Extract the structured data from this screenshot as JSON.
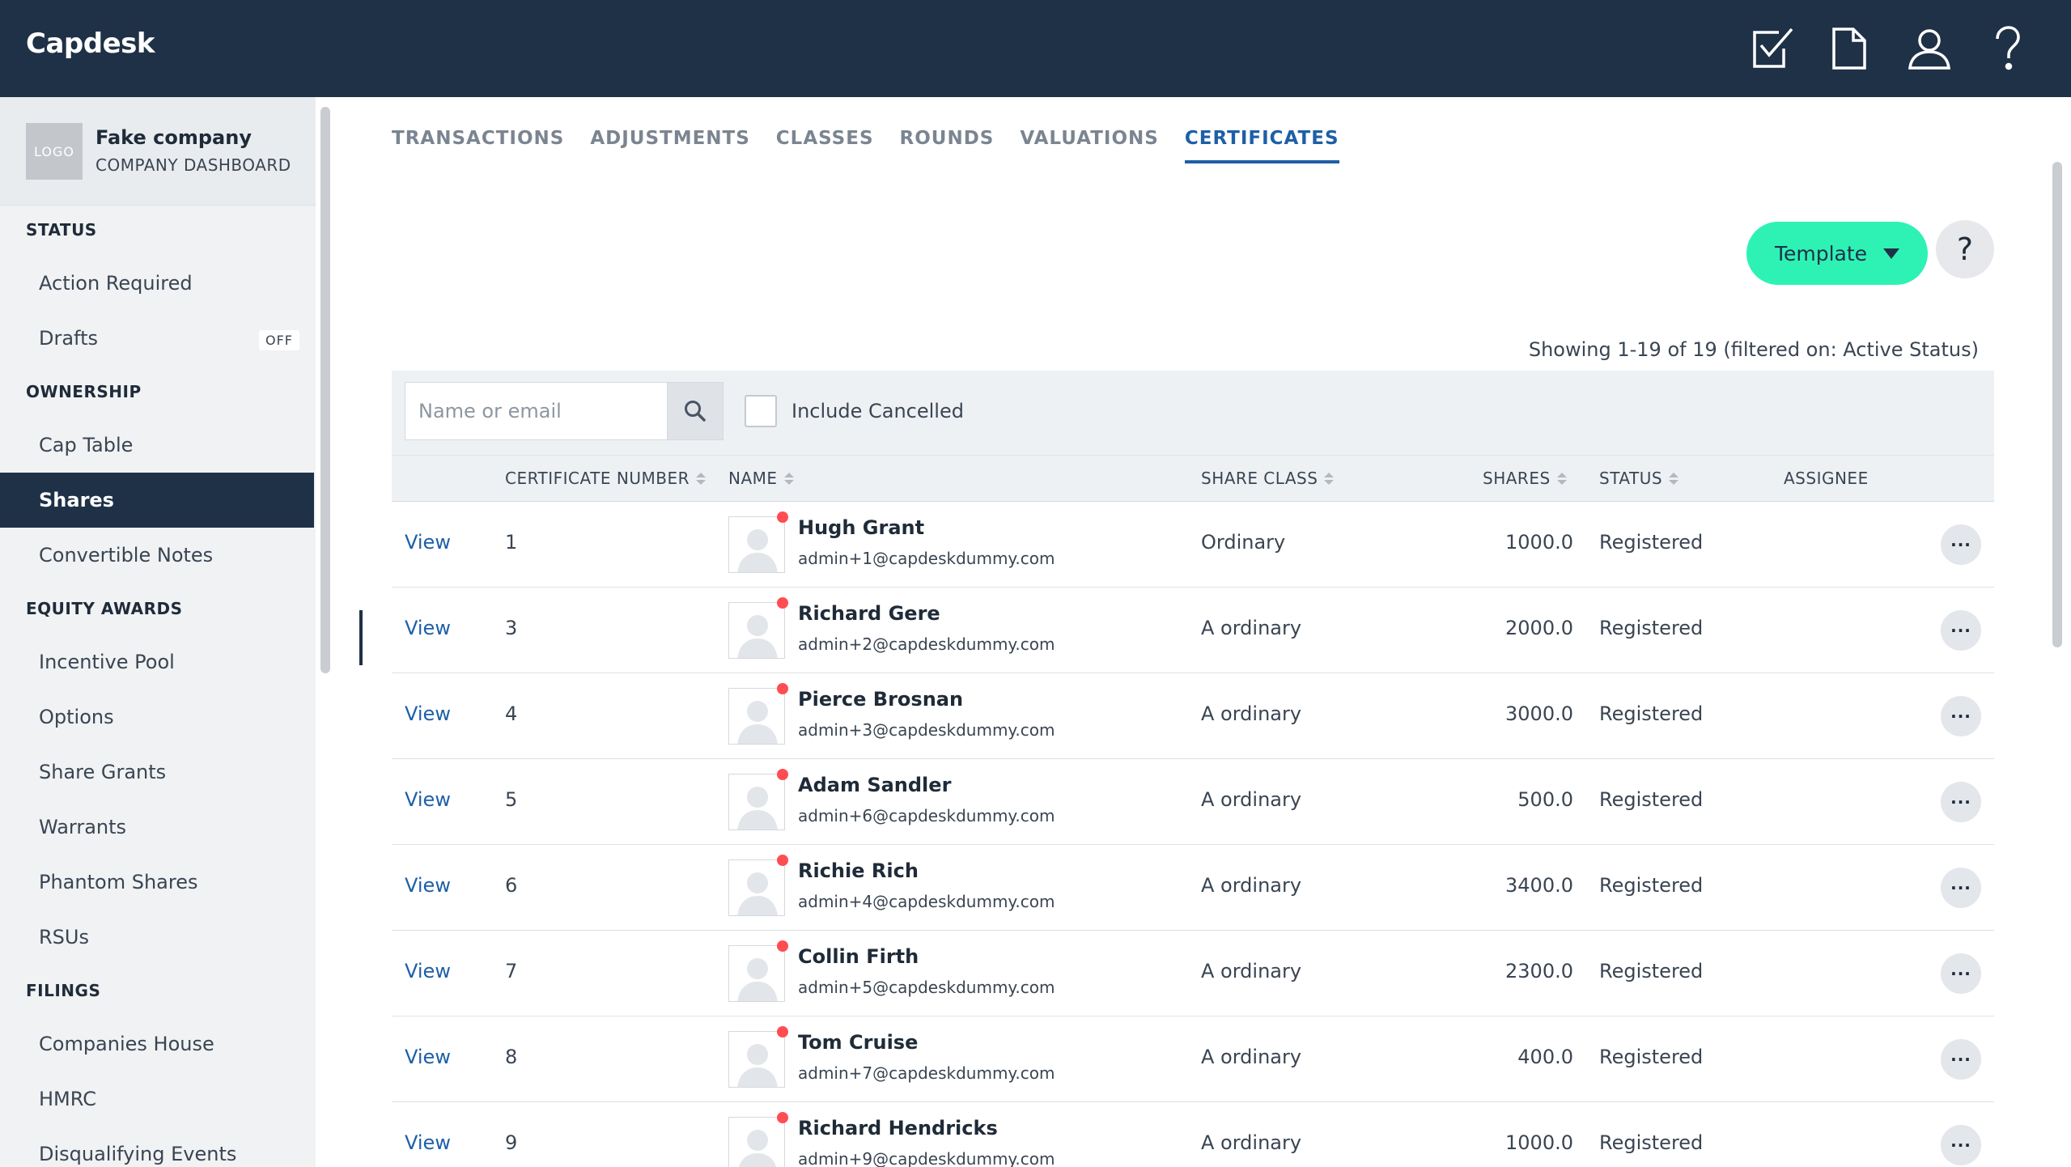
{
  "header": {
    "brand": "Capdesk",
    "icons": [
      "task-check-icon",
      "document-icon",
      "user-icon",
      "help-icon"
    ]
  },
  "sidebar": {
    "company": {
      "logo_text": "LOGO",
      "name": "Fake company",
      "subtitle": "COMPANY DASHBOARD"
    },
    "sections": [
      {
        "title": "STATUS",
        "items": [
          {
            "label": "Action Required"
          },
          {
            "label": "Drafts",
            "badge": "OFF"
          }
        ]
      },
      {
        "title": "OWNERSHIP",
        "items": [
          {
            "label": "Cap Table"
          },
          {
            "label": "Shares",
            "active": true
          },
          {
            "label": "Convertible Notes"
          }
        ]
      },
      {
        "title": "EQUITY AWARDS",
        "items": [
          {
            "label": "Incentive Pool"
          },
          {
            "label": "Options"
          },
          {
            "label": "Share Grants"
          },
          {
            "label": "Warrants"
          },
          {
            "label": "Phantom Shares"
          },
          {
            "label": "RSUs"
          }
        ]
      },
      {
        "title": "FILINGS",
        "items": [
          {
            "label": "Companies House"
          },
          {
            "label": "HMRC"
          },
          {
            "label": "Disqualifying Events"
          }
        ]
      }
    ]
  },
  "tabs": [
    {
      "label": "TRANSACTIONS"
    },
    {
      "label": "ADJUSTMENTS"
    },
    {
      "label": "CLASSES"
    },
    {
      "label": "ROUNDS"
    },
    {
      "label": "VALUATIONS"
    },
    {
      "label": "CERTIFICATES",
      "active": true
    }
  ],
  "toolbar": {
    "template_label": "Template",
    "help_label": "?"
  },
  "showing_text": "Showing 1-19 of 19 (filtered on: Active Status)",
  "filter": {
    "search_placeholder": "Name or email",
    "include_cancelled_label": "Include Cancelled"
  },
  "table": {
    "headers": {
      "certificate_number": "CERTIFICATE NUMBER",
      "name": "NAME",
      "share_class": "SHARE CLASS",
      "shares": "SHARES",
      "status": "STATUS",
      "assignee": "ASSIGNEE"
    },
    "view_label": "View",
    "more_label": "···",
    "rows": [
      {
        "cert": "1",
        "name": "Hugh Grant",
        "email": "admin+1@capdeskdummy.com",
        "share_class": "Ordinary",
        "shares": "1000.0",
        "status": "Registered"
      },
      {
        "cert": "3",
        "name": "Richard Gere",
        "email": "admin+2@capdeskdummy.com",
        "share_class": "A ordinary",
        "shares": "2000.0",
        "status": "Registered"
      },
      {
        "cert": "4",
        "name": "Pierce Brosnan",
        "email": "admin+3@capdeskdummy.com",
        "share_class": "A ordinary",
        "shares": "3000.0",
        "status": "Registered"
      },
      {
        "cert": "5",
        "name": "Adam Sandler",
        "email": "admin+6@capdeskdummy.com",
        "share_class": "A ordinary",
        "shares": "500.0",
        "status": "Registered"
      },
      {
        "cert": "6",
        "name": "Richie Rich",
        "email": "admin+4@capdeskdummy.com",
        "share_class": "A ordinary",
        "shares": "3400.0",
        "status": "Registered"
      },
      {
        "cert": "7",
        "name": "Collin Firth",
        "email": "admin+5@capdeskdummy.com",
        "share_class": "A ordinary",
        "shares": "2300.0",
        "status": "Registered"
      },
      {
        "cert": "8",
        "name": "Tom Cruise",
        "email": "admin+7@capdeskdummy.com",
        "share_class": "A ordinary",
        "shares": "400.0",
        "status": "Registered"
      },
      {
        "cert": "9",
        "name": "Richard Hendricks",
        "email": "admin+9@capdeskdummy.com",
        "share_class": "A ordinary",
        "shares": "1000.0",
        "status": "Registered"
      }
    ]
  },
  "colors": {
    "topbar": "#1f3147",
    "accent": "#2ef2b4",
    "link": "#1d5fa8",
    "status_dot": "#ff4d52"
  }
}
